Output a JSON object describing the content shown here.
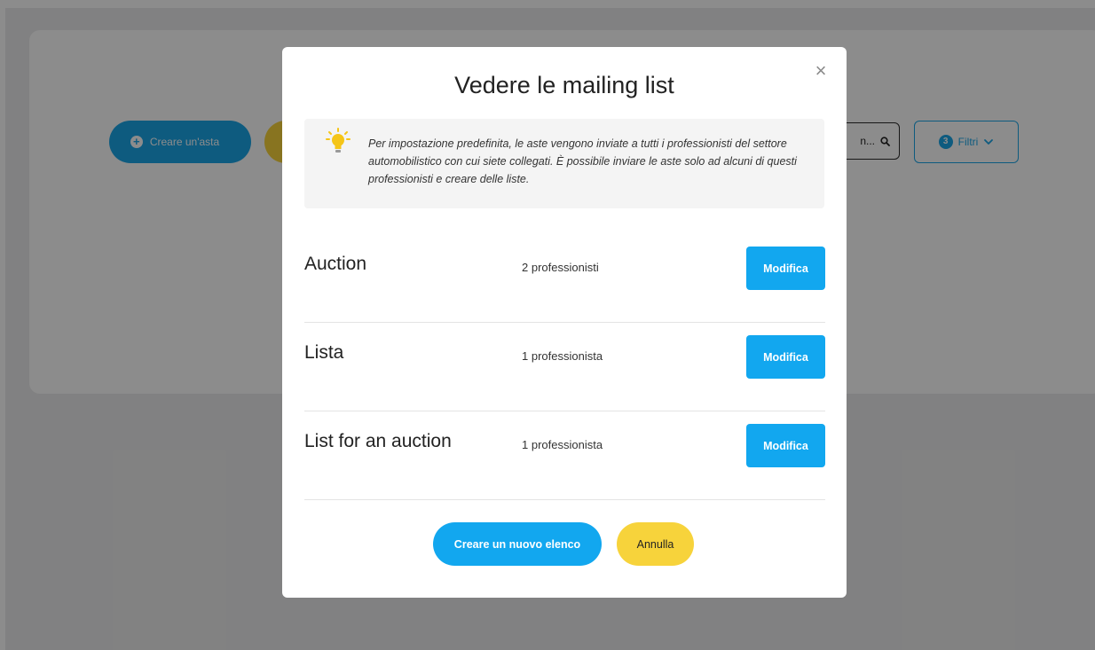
{
  "background": {
    "create_auction_label": "Creare un'asta",
    "search_placeholder": "n...",
    "filter_count": "3",
    "filter_label": "Filtri"
  },
  "modal": {
    "title": "Vedere le mailing list",
    "info_text": "Per impostazione predefinita, le aste vengono inviate a tutti i professionisti del settore automobilistico con cui siete collegati. È possibile inviare le aste solo ad alcuni di questi professionisti e creare delle liste.",
    "lists": [
      {
        "name": "Auction",
        "count": "2 professionisti",
        "edit_label": "Modifica"
      },
      {
        "name": "Lista",
        "count": "1 professionista",
        "edit_label": "Modifica"
      },
      {
        "name": "List for an auction",
        "count": "1 professionista",
        "edit_label": "Modifica"
      }
    ],
    "create_list_label": "Creare un nuovo elenco",
    "cancel_label": "Annulla"
  },
  "colors": {
    "primary": "#12a7ef",
    "accent_yellow": "#f7d33b"
  },
  "icons": [
    "plus-icon",
    "search-icon",
    "chevron-down-icon",
    "close-icon",
    "lightbulb-icon"
  ]
}
